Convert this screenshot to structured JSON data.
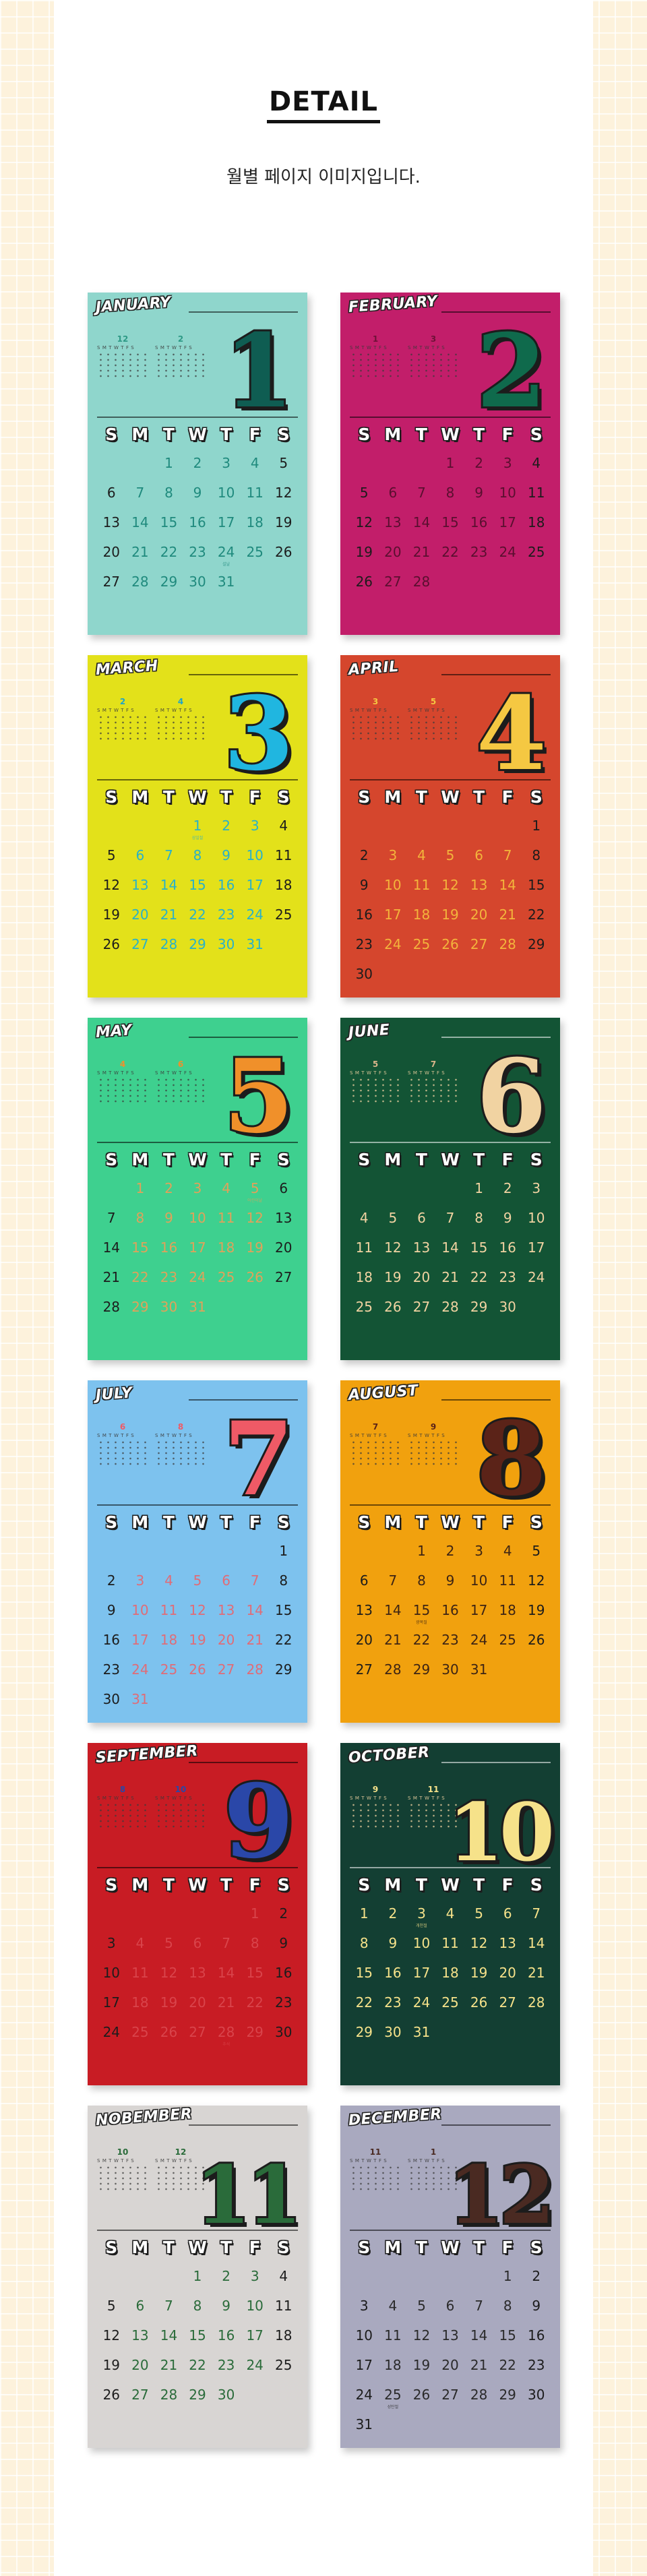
{
  "page": {
    "heading": "DETAIL",
    "subtitle": "월별 페이지 이미지입니다."
  },
  "weekday_labels": [
    "S",
    "M",
    "T",
    "W",
    "T",
    "F",
    "S"
  ],
  "mini_day_letters": "SMTWTFS",
  "months": [
    {
      "name": "JANUARY",
      "number": "1",
      "bg": "#8fd6cc",
      "num_fill": "#0f5d52",
      "num_color": "#1e5c57",
      "num_alt": "#2e9a86",
      "start": 2,
      "days": 31,
      "prev": "12",
      "next": "2",
      "weekend_color": "#1c1c1c",
      "weekday_color": "#1f8a7d",
      "note_day": 24,
      "note": "설날"
    },
    {
      "name": "FEBRUARY",
      "number": "2",
      "bg": "#c21e6a",
      "num_fill": "#0f6a4c",
      "num_color": "#2a2a2a",
      "num_alt": "#6d1237",
      "start": 3,
      "days": 28,
      "prev": "1",
      "next": "3",
      "weekend_color": "#1c1c1c",
      "weekday_color": "#5a0f2f",
      "note_day": null,
      "note": ""
    },
    {
      "name": "MARCH",
      "number": "3",
      "bg": "#e3e11a",
      "num_fill": "#20b6e0",
      "num_color": "#2a2a2a",
      "num_alt": "#1fa4c9",
      "start": 3,
      "days": 31,
      "prev": "2",
      "next": "4",
      "weekend_color": "#1c1c1c",
      "weekday_color": "#29b1c9",
      "note_day": 1,
      "note": "삼일절"
    },
    {
      "name": "APRIL",
      "number": "4",
      "bg": "#d5462d",
      "num_fill": "#f5c842",
      "num_color": "#2a2a2a",
      "num_alt": "#f5c842",
      "start": 6,
      "days": 30,
      "prev": "3",
      "next": "5",
      "weekend_color": "#1c1c1c",
      "weekday_color": "#f3b43c",
      "note_day": null,
      "note": ""
    },
    {
      "name": "MAY",
      "number": "5",
      "bg": "#3ed08f",
      "num_fill": "#f0902a",
      "num_color": "#2a2a2a",
      "num_alt": "#f0902a",
      "start": 1,
      "days": 31,
      "prev": "4",
      "next": "6",
      "weekend_color": "#1c1c1c",
      "weekday_color": "#e0a25a",
      "note_day": 5,
      "note": "어린이날"
    },
    {
      "name": "JUNE",
      "number": "6",
      "bg": "#135435",
      "num_fill": "#f1d3a2",
      "num_color": "#2a2a2a",
      "num_alt": "#d9b58a",
      "start": 4,
      "days": 30,
      "prev": "5",
      "next": "7",
      "weekend_color": "#f1d3a2",
      "weekday_color": "#f1d3a2",
      "note_day": null,
      "note": ""
    },
    {
      "name": "JULY",
      "number": "7",
      "bg": "#7dc2ee",
      "num_fill": "#ef5a66",
      "num_color": "#2a2a2a",
      "num_alt": "#ef5a66",
      "start": 6,
      "days": 31,
      "prev": "6",
      "next": "8",
      "weekend_color": "#1c1c1c",
      "weekday_color": "#e06c77",
      "note_day": null,
      "note": ""
    },
    {
      "name": "AUGUST",
      "number": "8",
      "bg": "#f1a10e",
      "num_fill": "#5b2318",
      "num_color": "#2a2a2a",
      "num_alt": "#5b2318",
      "start": 2,
      "days": 31,
      "prev": "7",
      "next": "9",
      "weekend_color": "#1c1c1c",
      "weekday_color": "#3d2414",
      "note_day": 15,
      "note": "광복절"
    },
    {
      "name": "SEPTEMBER",
      "number": "9",
      "bg": "#c81c24",
      "num_fill": "#2a47a8",
      "num_color": "#2a2a2a",
      "num_alt": "#2a47a8",
      "start": 5,
      "days": 30,
      "prev": "8",
      "next": "10",
      "weekend_color": "#1c1c1c",
      "weekday_color": "#d9444b",
      "note_day": 28,
      "note": "추석"
    },
    {
      "name": "OCTOBER",
      "number": "10",
      "bg": "#133f33",
      "num_fill": "#f6e28a",
      "num_color": "#2a2a2a",
      "num_alt": "#f6e28a",
      "start": 0,
      "days": 31,
      "prev": "9",
      "next": "11",
      "weekend_color": "#f6e28a",
      "weekday_color": "#f6e28a",
      "note_day": 3,
      "note": "개천절"
    },
    {
      "name": "NOBEMBER",
      "number": "11",
      "bg": "#d8d5d3",
      "num_fill": "#2a6b3a",
      "num_color": "#2a2a2a",
      "num_alt": "#2a6b3a",
      "start": 3,
      "days": 30,
      "prev": "10",
      "next": "12",
      "weekend_color": "#1c1c1c",
      "weekday_color": "#2a6b3a",
      "note_day": null,
      "note": ""
    },
    {
      "name": "DECEMBER",
      "number": "12",
      "bg": "#a9a9bf",
      "num_fill": "#4a2a22",
      "num_color": "#2a2a2a",
      "num_alt": "#4a2a22",
      "start": 5,
      "days": 31,
      "prev": "11",
      "next": "1",
      "weekend_color": "#1c1c1c",
      "weekday_color": "#2a2a2a",
      "note_day": 25,
      "note": "성탄절"
    }
  ]
}
